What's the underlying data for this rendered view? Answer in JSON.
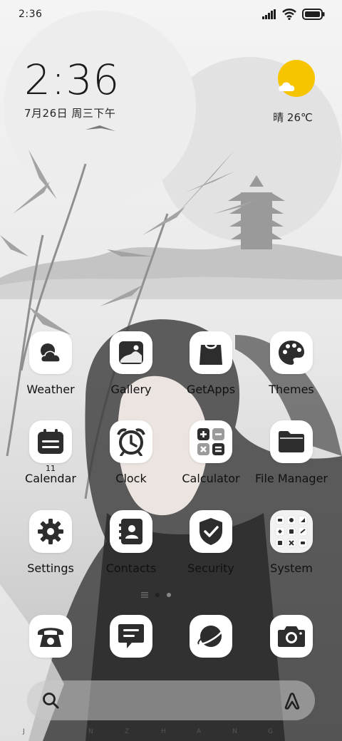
{
  "status_bar": {
    "time": "2:36",
    "icons": [
      "signal-icon",
      "wifi-icon",
      "battery-icon"
    ]
  },
  "clock_widget": {
    "time": "2:36",
    "date": "7月26日 周三下午"
  },
  "weather_widget": {
    "condition_icon": "sun-cloud-icon",
    "text": "晴 26℃",
    "sun_color": "#f7c400"
  },
  "apps": [
    {
      "label": "Weather",
      "icon": "weather-icon"
    },
    {
      "label": "Gallery",
      "icon": "gallery-icon"
    },
    {
      "label": "GetApps",
      "icon": "shopping-bag-icon"
    },
    {
      "label": "Themes",
      "icon": "palette-icon"
    },
    {
      "label": "Calendar",
      "icon": "calendar-icon",
      "badge": "11"
    },
    {
      "label": "Clock",
      "icon": "alarm-clock-icon"
    },
    {
      "label": "Calculator",
      "icon": "calculator-icon"
    },
    {
      "label": "File Manager",
      "icon": "folder-icon"
    },
    {
      "label": "Settings",
      "icon": "gear-icon"
    },
    {
      "label": "Contacts",
      "icon": "contacts-icon"
    },
    {
      "label": "Security",
      "icon": "shield-check-icon"
    },
    {
      "label": "System",
      "icon": "folder-grid-icon"
    }
  ],
  "dock": [
    {
      "icon": "phone-icon"
    },
    {
      "icon": "messages-icon"
    },
    {
      "icon": "browser-icon"
    },
    {
      "icon": "camera-icon"
    }
  ],
  "page_indicator": {
    "pages": 2,
    "current": 1
  },
  "search": {
    "left_icon": "search-icon",
    "right_icon": "assistant-icon"
  },
  "wallpaper_letters": [
    "J",
    "I",
    "N",
    "Z",
    "H",
    "A",
    "N",
    "G",
    "D",
    "E"
  ],
  "colors": {
    "icon_fg": "#2d2d2d",
    "icon_bg": "#ffffff",
    "accent_sun": "#f7c400"
  }
}
